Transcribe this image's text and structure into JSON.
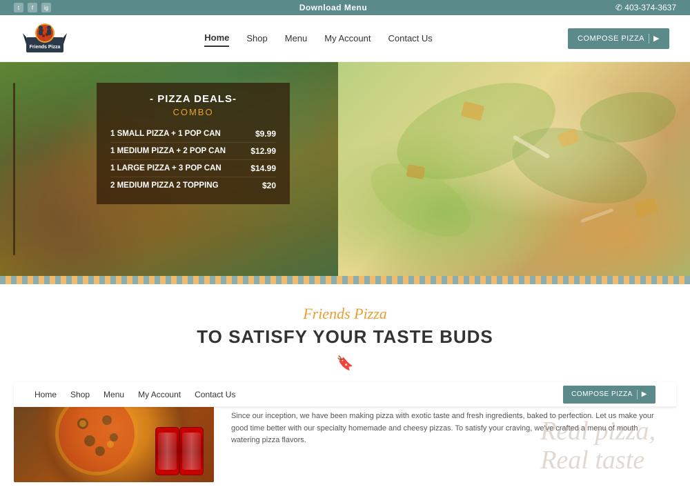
{
  "topbar": {
    "download_menu": "Download Menu",
    "phone": "✆ 403-374-3637",
    "social": [
      "t",
      "f",
      "ig"
    ]
  },
  "navbar": {
    "logo_text": "Friends Pizza",
    "links": [
      {
        "label": "Home",
        "active": true
      },
      {
        "label": "Shop",
        "active": false
      },
      {
        "label": "Menu",
        "active": false
      },
      {
        "label": "My Account",
        "active": false
      },
      {
        "label": "Contact Us",
        "active": false
      }
    ],
    "compose_btn": "COMPOSE PIZZA"
  },
  "hero": {
    "deals_title": "- PIZZA DEALS-",
    "deals_subtitle": "COMBO",
    "deals": [
      {
        "name": "1 SMALL PIZZA + 1 POP CAN",
        "price": "$9.99"
      },
      {
        "name": "1 MEDIUM PIZZA + 2 POP CAN",
        "price": "$12.99"
      },
      {
        "name": "1 LARGE PIZZA + 3 POP CAN",
        "price": "$14.99"
      },
      {
        "name": "2 MEDIUM PIZZA 2 TOPPING",
        "price": "$20"
      }
    ]
  },
  "content": {
    "brand_script": "Friends Pizza",
    "tagline": "TO SATISFY YOUR TASTE BUDS",
    "script_overlay_line1": "Real pizza,",
    "script_overlay_line2": "Real taste",
    "body_text": "Since our inception, we have been making pizza with exotic taste and fresh ingredients, baked to perfection. Let us make your good time better with our specialty homemade and cheesy pizzas. To satisfy your craving, we've crafted a menu of mouth watering pizza flavors.",
    "secondary_nav": {
      "links": [
        "Home",
        "Shop",
        "Menu",
        "My Account",
        "Contact Us"
      ],
      "compose_btn": "COMPOSE PIZZA"
    }
  }
}
